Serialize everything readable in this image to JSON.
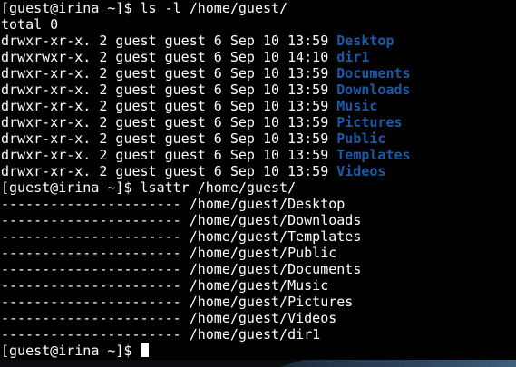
{
  "terminal": {
    "lines": [
      {
        "text": "[guest@irina ~]$ ls -l /home/guest/"
      },
      {
        "text": "total 0"
      },
      {
        "prefix": "drwxr-xr-x. 2 guest guest 6 Sep 10 13:59 ",
        "name": "Desktop"
      },
      {
        "prefix": "drwxrwxr-x. 2 guest guest 6 Sep 10 14:10 ",
        "name": "dir1"
      },
      {
        "prefix": "drwxr-xr-x. 2 guest guest 6 Sep 10 13:59 ",
        "name": "Documents"
      },
      {
        "prefix": "drwxr-xr-x. 2 guest guest 6 Sep 10 13:59 ",
        "name": "Downloads"
      },
      {
        "prefix": "drwxr-xr-x. 2 guest guest 6 Sep 10 13:59 ",
        "name": "Music"
      },
      {
        "prefix": "drwxr-xr-x. 2 guest guest 6 Sep 10 13:59 ",
        "name": "Pictures"
      },
      {
        "prefix": "drwxr-xr-x. 2 guest guest 6 Sep 10 13:59 ",
        "name": "Public"
      },
      {
        "prefix": "drwxr-xr-x. 2 guest guest 6 Sep 10 13:59 ",
        "name": "Templates"
      },
      {
        "prefix": "drwxr-xr-x. 2 guest guest 6 Sep 10 13:59 ",
        "name": "Videos"
      },
      {
        "text": "[guest@irina ~]$ lsattr /home/guest/"
      },
      {
        "text": "---------------------- /home/guest/Desktop"
      },
      {
        "text": "---------------------- /home/guest/Downloads"
      },
      {
        "text": "---------------------- /home/guest/Templates"
      },
      {
        "text": "---------------------- /home/guest/Public"
      },
      {
        "text": "---------------------- /home/guest/Documents"
      },
      {
        "text": "---------------------- /home/guest/Music"
      },
      {
        "text": "---------------------- /home/guest/Pictures"
      },
      {
        "text": "---------------------- /home/guest/Videos"
      },
      {
        "text": "---------------------- /home/guest/dir1"
      }
    ],
    "prompt": "[guest@irina ~]$ ",
    "colors": {
      "background": "#000000",
      "text": "#ffffff",
      "directory": "#1d5aa6"
    }
  }
}
